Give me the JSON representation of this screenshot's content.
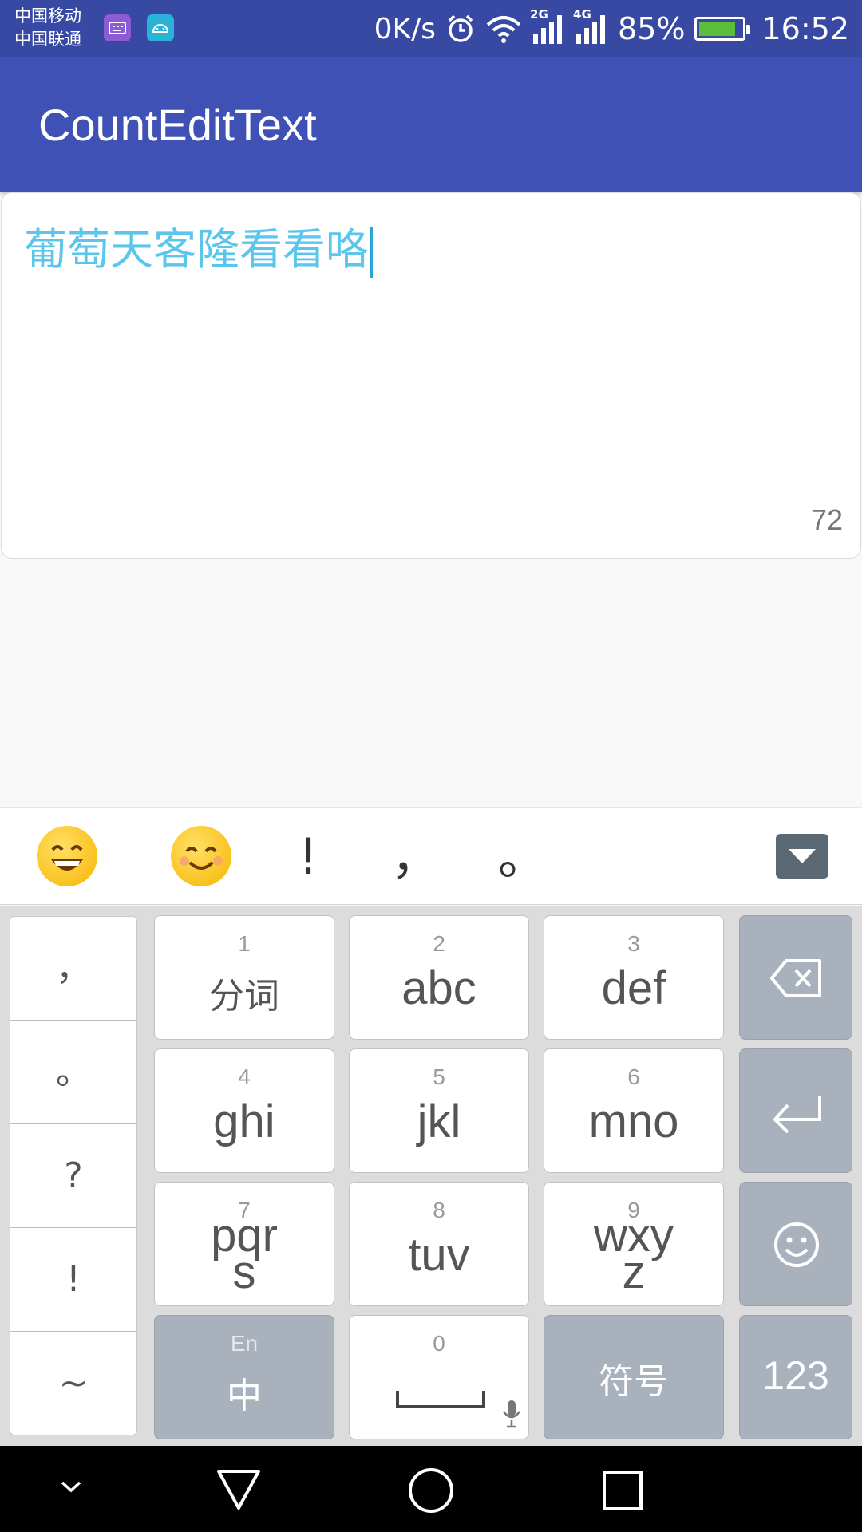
{
  "status_bar": {
    "carrier_1": "中国移动",
    "carrier_2": "中国联通",
    "net_speed": "0K/s",
    "network_2g": "2G",
    "network_4g": "4G",
    "battery": "85%",
    "battery_level": 0.85,
    "time": "16:52",
    "icons": [
      "keyboard-app-icon",
      "android-icon",
      "alarm-icon",
      "wifi-icon",
      "signal-icon",
      "battery-icon"
    ]
  },
  "app_bar": {
    "title": "CountEditText"
  },
  "editor": {
    "text": "葡萄天客隆看看咯",
    "remaining_count": "72"
  },
  "candidate_bar": {
    "items": [
      "😄",
      "😊",
      "!",
      "，",
      "。"
    ],
    "collapse_icon": "chevron-down-icon"
  },
  "keyboard": {
    "punctuation": [
      "，",
      "。",
      "?",
      "!",
      "~"
    ],
    "keys": [
      {
        "num": "1",
        "label": "分词"
      },
      {
        "num": "2",
        "label": "abc"
      },
      {
        "num": "3",
        "label": "def"
      },
      {
        "num": "4",
        "label": "ghi"
      },
      {
        "num": "5",
        "label": "jkl"
      },
      {
        "num": "6",
        "label": "mno"
      },
      {
        "num": "7",
        "label": "pqr",
        "label2": "s"
      },
      {
        "num": "8",
        "label": "tuv"
      },
      {
        "num": "9",
        "label": "wxy",
        "label2": "z"
      }
    ],
    "lang_key": {
      "small": "En",
      "main": "中"
    },
    "space_key": {
      "num": "0"
    },
    "symbol_key": "符号",
    "num_key": "123",
    "side_icons": [
      "backspace-icon",
      "enter-icon",
      "emoji-icon"
    ]
  },
  "nav_bar": {
    "icons": [
      "hide-keyboard-icon",
      "back-icon",
      "home-icon",
      "recents-icon"
    ]
  },
  "colors": {
    "status_bar": "#3849a4",
    "app_bar": "#3f51b5",
    "edit_text": "#5bc6ec",
    "key_dark": "#a9b1bc"
  }
}
